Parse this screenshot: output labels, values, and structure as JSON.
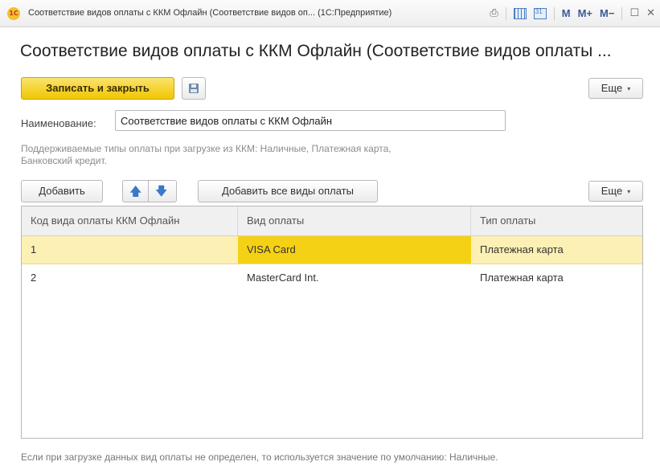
{
  "window": {
    "app_icon_text": "1C",
    "title": "Соответствие видов оплаты с ККМ Офлайн (Соответствие видов оп...  (1С:Предприятие)",
    "toolbar_icons": [
      "print-icon",
      "table-icon",
      "calendar-icon",
      "m-icon",
      "m-plus-icon",
      "m-minus-icon",
      "maximize-icon",
      "close-icon"
    ],
    "m_label": "M",
    "m_plus_label": "M+",
    "m_minus_label": "M−",
    "maximize_glyph": "☐",
    "close_glyph": "✕"
  },
  "page": {
    "title": "Соответствие видов оплаты с ККМ Офлайн (Соответствие видов оплаты ..."
  },
  "actions": {
    "save_close_label": "Записать и закрыть",
    "more_label": "Еще",
    "caret": "▾"
  },
  "form": {
    "name_label": "Наименование:",
    "name_value": "Соответствие видов оплаты с ККМ Офлайн",
    "hint": "Поддерживаемые типы оплаты при загрузке из ККМ: Наличные, Платежная карта, Банковский кредит."
  },
  "table_toolbar": {
    "add_label": "Добавить",
    "up_arrow": "🡅",
    "down_arrow": "🡇",
    "add_all_label": "Добавить все виды оплаты",
    "more_label": "Еще"
  },
  "table": {
    "columns": [
      "Код вида оплаты ККМ Офлайн",
      "Вид оплаты",
      "Тип оплаты"
    ],
    "rows": [
      {
        "code": "1",
        "payment_kind": "VISA Card",
        "payment_type": "Платежная карта"
      },
      {
        "code": "2",
        "payment_kind": "MasterCard Int.",
        "payment_type": "Платежная карта"
      }
    ]
  },
  "footer": {
    "note": "Если при загрузке данных вид оплаты не определен, то используется значение по умолчанию: Наличные."
  },
  "colors": {
    "primary_button": "#f0c600",
    "selected_row": "#fcf0b4",
    "selected_cell": "#f5d115",
    "arrow_blue": "#3a78c8"
  }
}
